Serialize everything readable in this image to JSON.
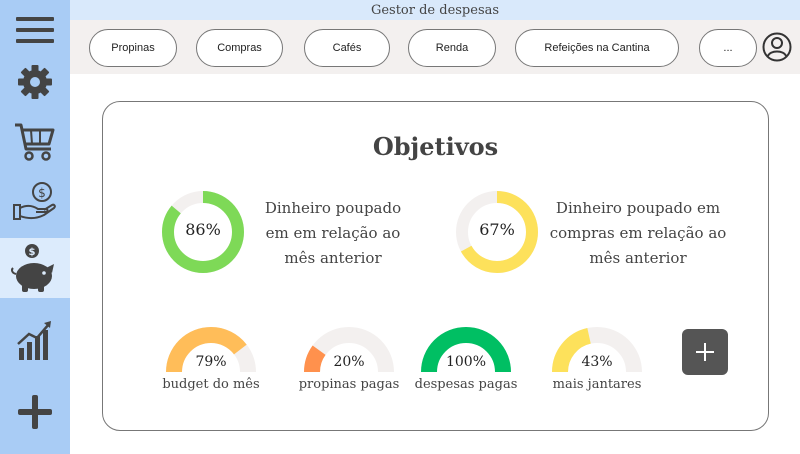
{
  "app": {
    "title": "Gestor de despesas"
  },
  "sidebar": {
    "items": [
      {
        "name": "menu",
        "icon": "hamburger-menu-icon"
      },
      {
        "name": "settings",
        "icon": "gear-icon"
      },
      {
        "name": "cart",
        "icon": "shopping-cart-icon"
      },
      {
        "name": "income",
        "icon": "hand-coin-icon"
      },
      {
        "name": "savings",
        "icon": "piggy-bank-icon",
        "active": true
      },
      {
        "name": "stats",
        "icon": "bar-chart-icon"
      },
      {
        "name": "add",
        "icon": "plus-icon"
      }
    ]
  },
  "categories": [
    "Propinas",
    "Compras",
    "Cafés",
    "Renda",
    "Refeições na Cantina",
    "..."
  ],
  "card": {
    "title": "Objetivos",
    "goals": [
      {
        "percent": 86,
        "label": "86%",
        "lines": [
          "Dinheiro poupado",
          "em em relação ao",
          "mês anterior"
        ],
        "color": "#7ed957"
      },
      {
        "percent": 67,
        "label": "67%",
        "lines": [
          "Dinheiro poupado em",
          "compras em relação ao",
          "mês anterior"
        ],
        "color": "#fde15b"
      }
    ],
    "gauges": [
      {
        "percent": 79,
        "label": "79%",
        "caption": "budget do mês",
        "color": "#ffbd59"
      },
      {
        "percent": 20,
        "label": "20%",
        "caption": "propinas pagas",
        "color": "#ff914d"
      },
      {
        "percent": 100,
        "label": "100%",
        "caption": "despesas pagas",
        "color": "#00bf63"
      },
      {
        "percent": 43,
        "label": "43%",
        "caption": "mais jantares",
        "color": "#fde15b"
      }
    ]
  },
  "colors": {
    "sidebar": "#a9ccf5",
    "sidebar_active": "#dcebfc",
    "track": "#f3f0ef",
    "icon": "#444444"
  }
}
